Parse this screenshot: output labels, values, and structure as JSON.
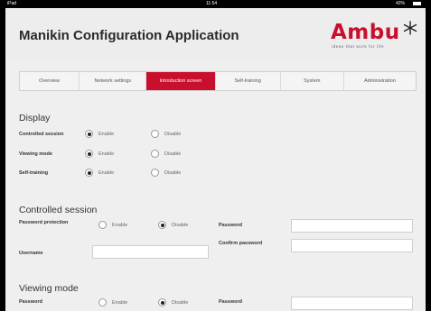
{
  "statusbar": {
    "left": "iPad",
    "time": "11:54",
    "right": "42%"
  },
  "app": {
    "title": "Manikin Configuration Application"
  },
  "logo": {
    "word": "Ambu",
    "tagline": "ideas that work for life"
  },
  "tabs": [
    "Overview",
    "Network settings",
    "Introduction screen",
    "Self-training",
    "System",
    "Administration"
  ],
  "active_tab": "Introduction screen",
  "colors": {
    "accent": "#c8102e",
    "background": "#efefef"
  },
  "display": {
    "title": "Display",
    "rows": [
      {
        "label": "Controlled session",
        "enable": "Enable",
        "disable": "Disable",
        "selected": "Enable"
      },
      {
        "label": "Viewing mode",
        "enable": "Enable",
        "disable": "Disable",
        "selected": "Enable"
      },
      {
        "label": "Self-training",
        "enable": "Enable",
        "disable": "Disable",
        "selected": "Enable"
      }
    ]
  },
  "controlled": {
    "title": "Controlled session",
    "password_protection_label": "Password protection",
    "enable": "Enable",
    "disable": "Disable",
    "selected": "Disable",
    "password_label": "Password",
    "confirm_label": "Confirm password",
    "username_label": "Username",
    "password_value": "",
    "confirm_value": "",
    "username_value": ""
  },
  "viewing": {
    "title": "Viewing mode",
    "password_label": "Password",
    "enable": "Enable",
    "disable": "Disable",
    "selected": "Disable",
    "password_field_label": "Password",
    "password_value": ""
  }
}
